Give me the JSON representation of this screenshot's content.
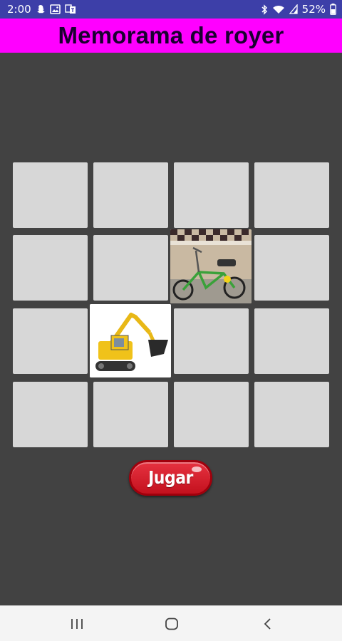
{
  "status_bar": {
    "time": "2:00",
    "battery": "52%",
    "left_icons": [
      "notification-snapchat-icon",
      "image-icon",
      "translate-icon"
    ],
    "right_icons": [
      "bluetooth-icon",
      "wifi-icon",
      "signal-icon",
      "battery-icon"
    ]
  },
  "app": {
    "title": "Memorama de royer",
    "title_bar_color": "#ff00ff",
    "background_color": "#424242"
  },
  "board": {
    "rows": 4,
    "columns": 4,
    "cards": [
      {
        "row": 1,
        "col": 1,
        "state": "hidden"
      },
      {
        "row": 1,
        "col": 2,
        "state": "hidden"
      },
      {
        "row": 1,
        "col": 3,
        "state": "hidden"
      },
      {
        "row": 1,
        "col": 4,
        "state": "hidden"
      },
      {
        "row": 2,
        "col": 1,
        "state": "hidden"
      },
      {
        "row": 2,
        "col": 2,
        "state": "hidden"
      },
      {
        "row": 2,
        "col": 3,
        "state": "revealed",
        "image": "bicycle"
      },
      {
        "row": 2,
        "col": 4,
        "state": "hidden"
      },
      {
        "row": 3,
        "col": 1,
        "state": "hidden"
      },
      {
        "row": 3,
        "col": 2,
        "state": "revealed",
        "image": "excavator"
      },
      {
        "row": 3,
        "col": 3,
        "state": "hidden"
      },
      {
        "row": 3,
        "col": 4,
        "state": "hidden"
      },
      {
        "row": 4,
        "col": 1,
        "state": "hidden"
      },
      {
        "row": 4,
        "col": 2,
        "state": "hidden"
      },
      {
        "row": 4,
        "col": 3,
        "state": "hidden"
      },
      {
        "row": 4,
        "col": 4,
        "state": "hidden"
      }
    ],
    "hidden_card_color": "#d7d7d7"
  },
  "play_button": {
    "label": "Jugar",
    "color": "#d81c2a"
  },
  "nav_bar": {
    "buttons": [
      "recent-apps-icon",
      "home-icon",
      "back-icon"
    ]
  }
}
